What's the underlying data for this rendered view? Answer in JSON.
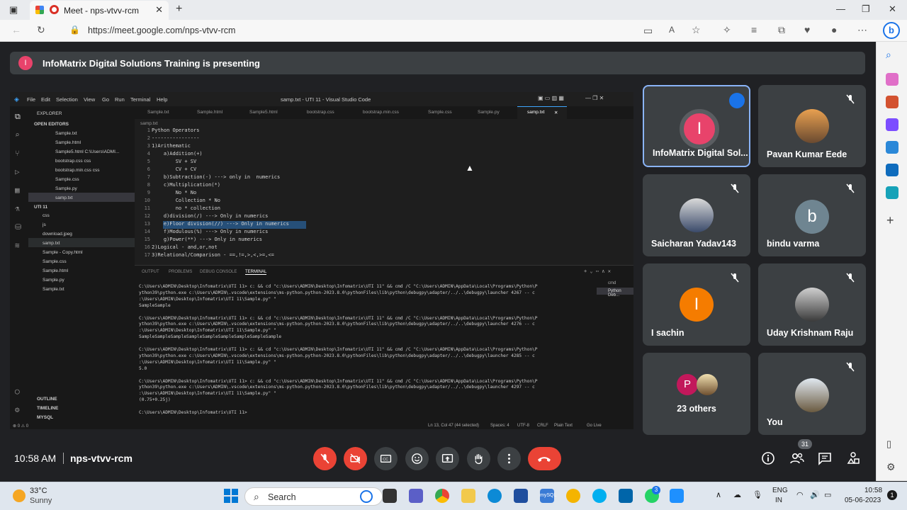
{
  "browser": {
    "tab_title": "Meet - nps-vtvv-rcm",
    "url": "https://meet.google.com/nps-vtvv-rcm"
  },
  "banner": {
    "avatar_letter": "I",
    "text": "InfoMatrix Digital Solutions Training is presenting"
  },
  "vscode": {
    "title": "samp.txt - UTI 11 - Visual Studio Code",
    "menu": [
      "File",
      "Edit",
      "Selection",
      "View",
      "Go",
      "Run",
      "Terminal",
      "Help"
    ],
    "explorer_label": "EXPLORER",
    "open_editors_label": "OPEN EDITORS",
    "open_editors": [
      "Sample.txt",
      "Sample.html",
      "Sample5.html  C:\\Users\\ADMI...",
      "bootstrap.css  css",
      "bootstrap.min.css  css",
      "Sample.css",
      "Sample.py",
      "samp.txt"
    ],
    "folder_label": "UTI 11",
    "folder_items": [
      "css",
      "js",
      "download.jpeg",
      "samp.txt",
      "Sample - Copy.html",
      "Sample.css",
      "Sample.html",
      "Sample.py",
      "Sample.txt"
    ],
    "outline_label": "OUTLINE",
    "timeline_label": "TIMELINE",
    "mysql_label": "MYSQL",
    "tabs": [
      "Sample.txt",
      "Sample.html",
      "Sample5.html",
      "bootstrap.css",
      "bootstrap.min.css",
      "Sample.css",
      "Sample.py",
      "samp.txt"
    ],
    "breadcrumb": "samp.txt",
    "code_lines": [
      "Python Operators",
      "----------------",
      "1)Arithematic",
      "    a)Addition(+)",
      "        SV + SV",
      "        CV + CV",
      "    b)Subtraction(-) ---> only in  numerics",
      "    c)Multiplication(*)",
      "        No * No",
      "        Collection * No",
      "        no * collection",
      "    d)division(/) ---> Only in numerics",
      "    e)Floor division(//) ---> Only in numerics",
      "    f)Modulous(%) ---> Only in numerics",
      "    g)Power(**) ---> Only in numerics",
      "2)Logical - and,or,not",
      "3)Relational/Comparison - ==,!=,>,<,>=,<="
    ],
    "line_numbers": [
      "1",
      "2",
      "3",
      "4",
      "5",
      "6",
      "7",
      "8",
      "9",
      "10",
      "11",
      "12",
      "13",
      "14",
      "15",
      "16",
      "17"
    ],
    "panel_tabs": [
      "OUTPUT",
      "PROBLEMS",
      "DEBUG CONSOLE",
      "TERMINAL"
    ],
    "terminal_side": [
      "cmd",
      "Python Deb..."
    ],
    "terminal_lines": [
      "C:\\Users\\ADMIN\\Desktop\\Infomatrix\\UTI 11> c: && cd \"c:\\Users\\ADMIN\\Desktop\\Infomatrix\\UTI 11\" && cmd /C \"C:\\Users\\ADMIN\\AppData\\Local\\Programs\\Python\\P",
      "ython39\\python.exe c:\\Users\\ADMIN\\.vscode\\extensions\\ms-python.python-2023.8.0\\pythonFiles\\lib\\python\\debugpy\\adapter/../..\\debugpy\\launcher 4267 -- c",
      ":\\Users\\ADMIN\\Desktop\\Infomatrix\\UTI 11\\Sample.py\" \"",
      "SampleSample",
      "",
      "C:\\Users\\ADMIN\\Desktop\\Infomatrix\\UTI 11> c: && cd \"c:\\Users\\ADMIN\\Desktop\\Infomatrix\\UTI 11\" && cmd /C \"C:\\Users\\ADMIN\\AppData\\Local\\Programs\\Python\\P",
      "ython39\\python.exe c:\\Users\\ADMIN\\.vscode\\extensions\\ms-python.python-2023.8.0\\pythonFiles\\lib\\python\\debugpy\\adapter/../..\\debugpy\\launcher 4276 -- c",
      ":\\Users\\ADMIN\\Desktop\\Infomatrix\\UTI 11\\Sample.py\" \"",
      "SampleSampleSampleSampleSampleSampleSampleSampleSample",
      "",
      "C:\\Users\\ADMIN\\Desktop\\Infomatrix\\UTI 11> c: && cd \"c:\\Users\\ADMIN\\Desktop\\Infomatrix\\UTI 11\" && cmd /C \"C:\\Users\\ADMIN\\AppData\\Local\\Programs\\Python\\P",
      "ython39\\python.exe c:\\Users\\ADMIN\\.vscode\\extensions\\ms-python.python-2023.8.0\\pythonFiles\\lib\\python\\debugpy\\adapter/../..\\debugpy\\launcher 4285 -- c",
      ":\\Users\\ADMIN\\Desktop\\Infomatrix\\UTI 11\\Sample.py\" \"",
      "5.0",
      "",
      "C:\\Users\\ADMIN\\Desktop\\Infomatrix\\UTI 11> c: && cd \"c:\\Users\\ADMIN\\Desktop\\Infomatrix\\UTI 11\" && cmd /C \"C:\\Users\\ADMIN\\AppData\\Local\\Programs\\Python\\P",
      "ython39\\python.exe c:\\Users\\ADMIN\\.vscode\\extensions\\ms-python.python-2023.8.0\\pythonFiles\\lib\\python\\debugpy\\adapter/../..\\debugpy\\launcher 4297 -- c",
      ":\\Users\\ADMIN\\Desktop\\Infomatrix\\UTI 11\\Sample.py\" \"",
      "(0.75+0.25j)",
      "",
      "C:\\Users\\ADMIN\\Desktop\\Infomatrix\\UTI 11>"
    ],
    "status": {
      "problems": "⊗ 0 ⚠ 0",
      "position": "Ln 13, Col 47 (44 selected)",
      "spaces": "Spaces: 4",
      "encoding": "UTF-8",
      "eol": "CRLF",
      "language": "Plain Text",
      "golive": "Go Live"
    }
  },
  "participants": [
    {
      "name": "InfoMatrix Digital Sol...",
      "letter": "I",
      "color": "#e8436b",
      "speaking": true
    },
    {
      "name": "Pavan Kumar Eede",
      "muted": true
    },
    {
      "name": "Saicharan Yadav143",
      "muted": true
    },
    {
      "name": "bindu varma",
      "letter": "b",
      "color": "#6f8591",
      "muted": true
    },
    {
      "name": "I sachin",
      "letter": "I",
      "color": "#f57c00",
      "muted": true
    },
    {
      "name": "Uday Krishnam Raju",
      "muted": true
    },
    {
      "name": "23 others",
      "letter": "P",
      "color": "#c2185b"
    },
    {
      "name": "You",
      "muted": true
    }
  ],
  "bottom": {
    "time": "10:58 AM",
    "meeting_code": "nps-vtvv-rcm",
    "people_count": "31"
  },
  "taskbar": {
    "weather_temp": "33°C",
    "weather_desc": "Sunny",
    "search_label": "Search",
    "lang_line1": "ENG",
    "lang_line2": "IN",
    "time": "10:58",
    "date": "05-06-2023",
    "whatsapp_badge": "3"
  }
}
